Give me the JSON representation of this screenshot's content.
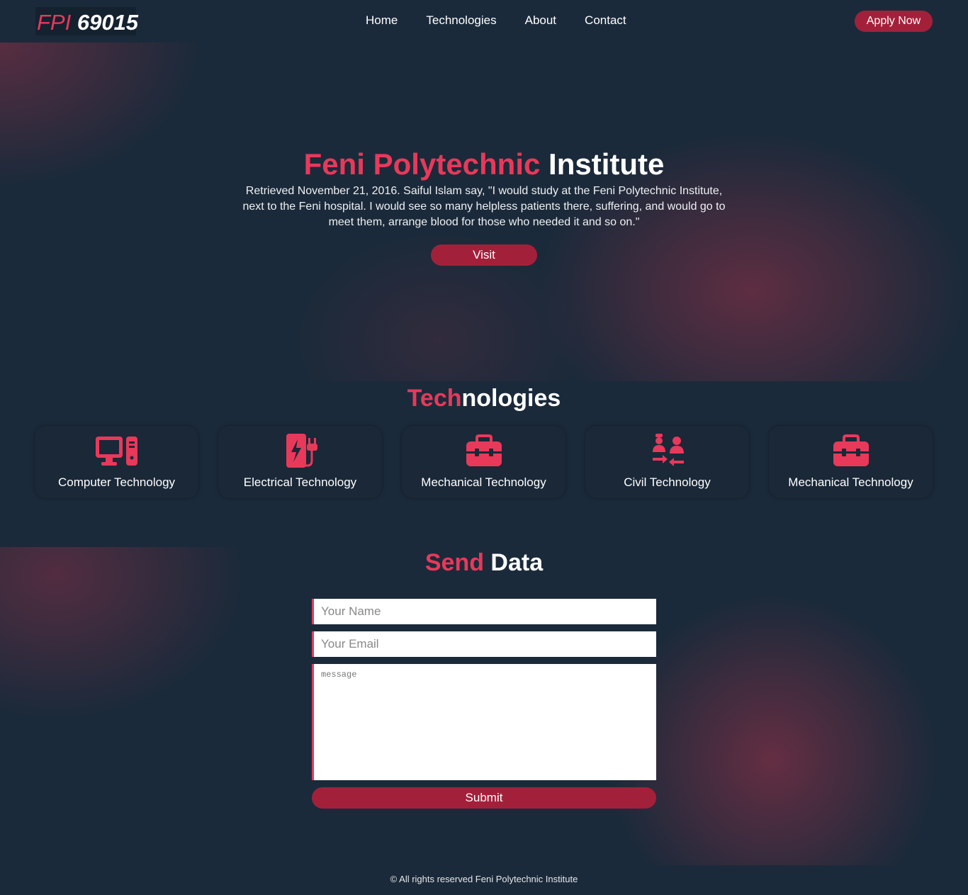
{
  "nav": {
    "logo_lead": "FPI",
    "logo_rest": " 69015",
    "links": [
      "Home",
      "Technologies",
      "About",
      "Contact"
    ],
    "apply_label": "Apply Now"
  },
  "hero": {
    "title_accent": "Feni Polytechnic",
    "title_rest": " Institute",
    "quote": "Retrieved November 21, 2016. Saiful Islam say, \"I would study at the Feni Polytechnic Institute, next to the Feni hospital. I would see so many helpless patients there, suffering, and would go to meet them, arrange blood for those who needed it and so on.\"",
    "visit_label": "Visit"
  },
  "technologies": {
    "title_accent": "Tech",
    "title_rest": "nologies",
    "items": [
      {
        "label": "Computer Technology",
        "icon": "computer-icon"
      },
      {
        "label": "Electrical Technology",
        "icon": "charging-station-icon"
      },
      {
        "label": "Mechanical Technology",
        "icon": "toolbox-icon"
      },
      {
        "label": "Civil Technology",
        "icon": "people-exchange-icon"
      },
      {
        "label": "Mechanical Technology",
        "icon": "toolbox-icon"
      }
    ]
  },
  "send": {
    "title_accent": "Send",
    "title_rest": " Data",
    "name_placeholder": "Your Name",
    "email_placeholder": "Your Email",
    "message_placeholder": "message",
    "submit_label": "Submit"
  },
  "footer": {
    "text": "© All rights reserved Feni Polytechnic Institute"
  },
  "colors": {
    "accent": "#e8395a",
    "button": "#a3203a",
    "background": "#1b2a3a"
  }
}
